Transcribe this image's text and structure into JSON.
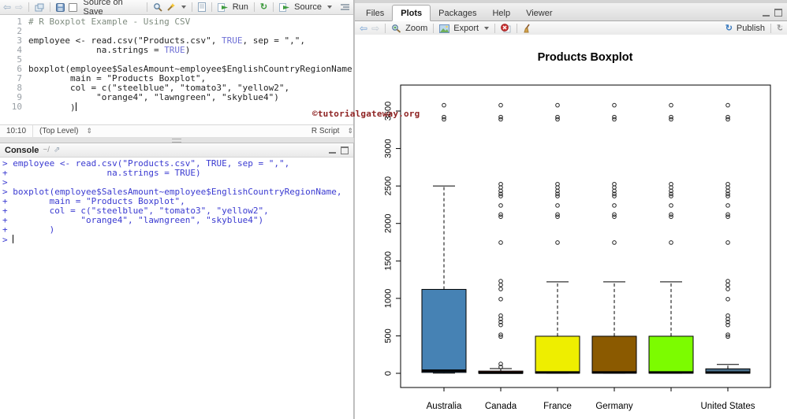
{
  "watermark": {
    "text": "©tutorialgateway.org",
    "color": "#8e2323"
  },
  "icons": {
    "back": "⇦",
    "forward": "⇨",
    "updown": "⇕",
    "share": "⇗",
    "rerun": "↻",
    "publish_glyph": "↻",
    "refresh_glyph": "↻"
  },
  "source_pane": {
    "toolbar": {
      "source_on_save_label": "Source on Save",
      "run_label": "Run",
      "source_label": "Source"
    },
    "editor": {
      "lines": [
        {
          "n": "1",
          "segs": [
            {
              "s": "comment",
              "t": "# R Boxplot Example - Using CSV"
            }
          ]
        },
        {
          "n": "2",
          "segs": []
        },
        {
          "n": "3",
          "segs": [
            {
              "s": "plain",
              "t": "employee <- read.csv(\"Products.csv\", "
            },
            {
              "s": "const",
              "t": "TRUE"
            },
            {
              "s": "plain",
              "t": ", sep = \",\","
            }
          ]
        },
        {
          "n": "4",
          "segs": [
            {
              "s": "plain",
              "t": "             na.strings = "
            },
            {
              "s": "const",
              "t": "TRUE"
            },
            {
              "s": "plain",
              "t": ")"
            }
          ]
        },
        {
          "n": "5",
          "segs": []
        },
        {
          "n": "6",
          "segs": [
            {
              "s": "plain",
              "t": "boxplot(employee$SalesAmount~employee$EnglishCountryRegionName,"
            }
          ]
        },
        {
          "n": "7",
          "segs": [
            {
              "s": "plain",
              "t": "        main = \"Products Boxplot\","
            }
          ]
        },
        {
          "n": "8",
          "segs": [
            {
              "s": "plain",
              "t": "        col = c(\"steelblue\", \"tomato3\", \"yellow2\","
            }
          ]
        },
        {
          "n": "9",
          "segs": [
            {
              "s": "plain",
              "t": "             \"orange4\", \"lawngreen\", \"skyblue4\")"
            }
          ]
        },
        {
          "n": "10",
          "segs": [
            {
              "s": "plain",
              "t": "        )"
            }
          ],
          "cursor": true
        }
      ]
    },
    "status_bar": {
      "cursor_position": "10:10",
      "scope": "(Top Level)",
      "file_type": "R Script"
    }
  },
  "console_pane": {
    "title": "Console",
    "path": "~/",
    "lines": [
      "> employee <- read.csv(\"Products.csv\", TRUE, sep = \",\",",
      "+                   na.strings = TRUE)",
      ">",
      "> boxplot(employee$SalesAmount~employee$EnglishCountryRegionName,",
      "+        main = \"Products Boxplot\",",
      "+        col = c(\"steelblue\", \"tomato3\", \"yellow2\",",
      "+              \"orange4\", \"lawngreen\", \"skyblue4\")",
      "+        )"
    ],
    "prompt": "> "
  },
  "right_pane": {
    "tabs": [
      {
        "label": "Files",
        "active": false
      },
      {
        "label": "Plots",
        "active": true
      },
      {
        "label": "Packages",
        "active": false
      },
      {
        "label": "Help",
        "active": false
      },
      {
        "label": "Viewer",
        "active": false
      }
    ],
    "toolbar": {
      "zoom_label": "Zoom",
      "export_label": "Export",
      "publish_label": "Publish"
    }
  },
  "chart_data": {
    "type": "boxplot",
    "title": "Products Boxplot",
    "xlabel": "",
    "ylabel": "",
    "ylim": [
      0,
      3700
    ],
    "yticks": [
      0,
      500,
      1000,
      1500,
      2000,
      2500,
      3000,
      3500
    ],
    "grid": false,
    "categories": [
      "Australia",
      "Canada",
      "France",
      "Germany",
      "",
      "United States"
    ],
    "series": [
      {
        "name": "Australia",
        "color": "#4682B4",
        "color_name": "steelblue",
        "whisker_low": 2,
        "q1": 12,
        "median": 35,
        "q3": 1120,
        "whisker_high": 2500,
        "outliers": [
          3390,
          3420,
          3578
        ]
      },
      {
        "name": "Canada",
        "color": "#CD4F39",
        "color_name": "tomato3",
        "whisker_low": 0,
        "q1": 1,
        "median": 8,
        "q3": 30,
        "whisker_high": 63,
        "outliers": [
          85,
          125,
          490,
          515,
          645,
          685,
          725,
          770,
          990,
          1125,
          1180,
          1230,
          1745,
          2090,
          2120,
          2240,
          2365,
          2395,
          2435,
          2480,
          2525,
          3390,
          3420,
          3578
        ]
      },
      {
        "name": "France",
        "color": "#EEEE00",
        "color_name": "yellow2",
        "whisker_low": 0,
        "q1": 2,
        "median": 12,
        "q3": 495,
        "whisker_high": 1220,
        "outliers": [
          1745,
          2090,
          2120,
          2240,
          2365,
          2395,
          2435,
          2480,
          2525,
          3390,
          3420,
          3578
        ]
      },
      {
        "name": "Germany",
        "color": "#8B5A00",
        "color_name": "orange4",
        "whisker_low": 0,
        "q1": 2,
        "median": 12,
        "q3": 495,
        "whisker_high": 1220,
        "outliers": [
          1745,
          2090,
          2120,
          2240,
          2365,
          2395,
          2435,
          2480,
          2525,
          3390,
          3420,
          3578
        ]
      },
      {
        "name": "",
        "color": "#7CFC00",
        "color_name": "lawngreen",
        "whisker_low": 0,
        "q1": 2,
        "median": 12,
        "q3": 495,
        "whisker_high": 1220,
        "outliers": [
          1745,
          2090,
          2120,
          2240,
          2365,
          2395,
          2435,
          2480,
          2525,
          3390,
          3420,
          3578
        ]
      },
      {
        "name": "United States",
        "color": "#4A708B",
        "color_name": "skyblue4",
        "whisker_low": 0,
        "q1": 1,
        "median": 10,
        "q3": 60,
        "whisker_high": 118,
        "outliers": [
          490,
          515,
          645,
          685,
          725,
          770,
          990,
          1125,
          1180,
          1230,
          1745,
          2090,
          2120,
          2240,
          2365,
          2395,
          2435,
          2480,
          2525,
          3390,
          3420,
          3578
        ]
      }
    ]
  }
}
